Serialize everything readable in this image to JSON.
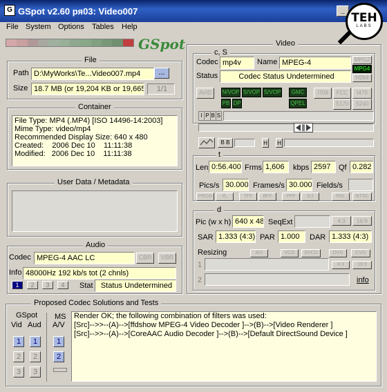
{
  "window": {
    "title": "GSpot v2.60 ря03: Video007",
    "icon": "gspot-app-icon"
  },
  "logo": {
    "big": "TEH",
    "small": "LABS"
  },
  "menu": [
    "File",
    "System",
    "Options",
    "Tables",
    "Help"
  ],
  "brand_text": "GSpot",
  "file": {
    "legend": "File",
    "path_label": "Path",
    "path_value": "D:\\MyWorks\\Te...Video007.mp4",
    "browse_label": "...",
    "size_label": "Size",
    "size_value": "18.7 MB (or 19,204 KB or 19,665,",
    "page_value": "1/1"
  },
  "container": {
    "legend": "Container",
    "lines": [
      "File Type: MP4 (.MP4) [ISO 14496-14:2003]",
      "Mime Type: video/mp4",
      "Recommended Display Size: 640 x 480",
      "Created:    2006 Dec 10    11:11:38",
      "Modified:   2006 Dec 10    11:11:38"
    ]
  },
  "userdata": {
    "legend": "User Data / Metadata"
  },
  "audio": {
    "legend": "Audio",
    "codec_label": "Codec",
    "codec_value": "MPEG-4 AAC LC",
    "cbr": "CBR",
    "vbr": "VBR",
    "info_label": "Info",
    "info_value": "48000Hz  192 kb/s tot (2 chnls)",
    "streams": [
      "1",
      "2",
      "3",
      "4"
    ],
    "stat_label": "Stat",
    "stat_value": "Status Undetermined"
  },
  "video": {
    "legend": "Video",
    "cs_legend": "c, S",
    "codec_label": "Codec",
    "codec_value": "mp4v",
    "name_label": "Name",
    "name_value": "MPEG-4",
    "mpg2": "MPG2",
    "mpg4": "MPG4",
    "h264": "H264",
    "status_label": "Status",
    "status_value": "Codec Status Undetermined",
    "avid": "AVID",
    "nvop": "N/VOP",
    "svop": "S/VOP",
    "svop2": "S/VOP",
    "gmc": "GMC",
    "qpel": "QPEL",
    "pb": "PB",
    "dp": "DP",
    "i709": "I709",
    "fcc": "FCC",
    "i470": "I470",
    "s170": "S170",
    "s240": "S240",
    "ipbs": [
      "I",
      "P",
      "B",
      "S"
    ],
    "t_legend": "t",
    "len_label": "Len",
    "len_value": "0:56.400",
    "frms_label": "Frms",
    "frms_value": "1,606",
    "kbps_label": "kbps",
    "kbps_value": "2597",
    "qf_label": "Qf",
    "qf_value": "0.282",
    "pics_label": "Pics/s",
    "pics_value": "30.000",
    "frames_label": "Frames/s",
    "frames_value": "30.000",
    "fields_label": "Fields/s",
    "flags": [
      "PROG",
      "I/L",
      "TFF",
      "BFF",
      "PPF",
      "3:2",
      "PAL",
      "NTSC"
    ],
    "d_legend": "d",
    "pic_label": "Pic (w x h)",
    "pic_value": "640 x 48",
    "seqext_label": "SeqExt",
    "r43": "4:3",
    "r169": "16:9",
    "sar_label": "SAR",
    "sar_value": "1.333 (4:3)",
    "par_label": "PAR",
    "par_value": "1.000",
    "dar_label": "DAR",
    "dar_value": "1.333 (4:3)",
    "resizing_label": "Resizing",
    "resize_btns": [
      "AVI",
      "VCD",
      "SVCD",
      "DVD",
      "CVD"
    ],
    "row1": "1",
    "row2": "2",
    "info_link": "info"
  },
  "proposed": {
    "legend": "Proposed Codec Solutions and Tests",
    "gspot_label": "GSpot",
    "vid_label": "Vid",
    "aud_label": "Aud",
    "ms_label": "MS",
    "av_label": "A/V",
    "lines": [
      "Render OK; the following combination of filters was used:",
      "[Src]-->>--(A)-->[ffdshow MPEG-4 Video Decoder ]-->(B)-->[Video Renderer ]",
      "[Src]-->>--(A)-->[CoreAAC Audio Decoder ]-->(B)-->[Default DirectSound Device ]"
    ]
  }
}
